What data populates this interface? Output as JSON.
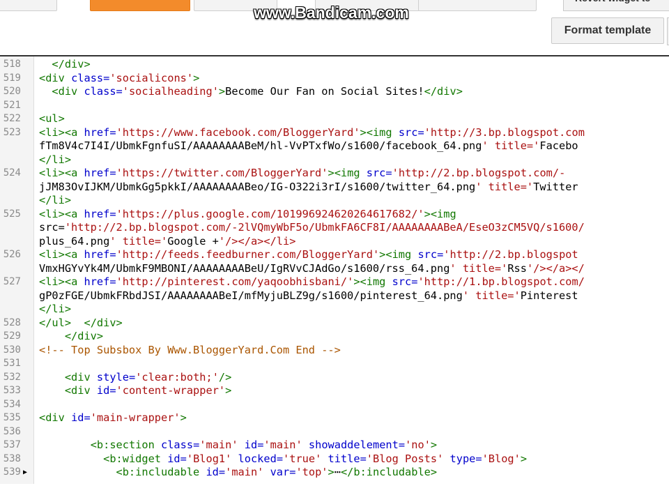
{
  "watermark": "www.Bandicam.com",
  "toolbar": {
    "format_template": "Format template",
    "revert_widget": "Revert widget te"
  },
  "editor": {
    "lines": [
      {
        "n": "518",
        "code": "  </div>"
      },
      {
        "n": "519",
        "code": "<div class='socialicons'>"
      },
      {
        "n": "520",
        "code": "  <div class='socialheading'>Become Our Fan on Social Sites!</div>"
      },
      {
        "n": "521",
        "code": ""
      },
      {
        "n": "522",
        "code": "<ul>"
      },
      {
        "n": "523",
        "code": "<li><a href='https://www.facebook.com/BloggerYard'><img src='http://3.bp.blogspot.com"
      },
      {
        "n": "",
        "code": "fTm8V4c7I4I/UbmkFgnfuSI/AAAAAAAABeM/hl-VvPTxfWo/s1600/facebook_64.png' title='Facebo"
      },
      {
        "n": "",
        "code": "</li>"
      },
      {
        "n": "524",
        "code": "<li><a href='https://twitter.com/BloggerYard'><img src='http://2.bp.blogspot.com/-"
      },
      {
        "n": "",
        "code": "jJM83OvIJKM/UbmkGg5pkkI/AAAAAAAABeo/IG-O322i3rI/s1600/twitter_64.png' title='Twitter"
      },
      {
        "n": "",
        "code": "</li>"
      },
      {
        "n": "525",
        "code": "<li><a href='https://plus.google.com/101996924620264617682/'><img"
      },
      {
        "n": "",
        "code": "src='http://2.bp.blogspot.com/-2lVQmyWbF5o/UbmkFA6CF8I/AAAAAAAABeA/EseO3zCM5VQ/s1600/"
      },
      {
        "n": "",
        "code": "plus_64.png' title='Google +'/></a></li>"
      },
      {
        "n": "526",
        "code": "<li><a href='http://feeds.feedburner.com/BloggerYard'><img src='http://2.bp.blogspot"
      },
      {
        "n": "",
        "code": "VmxHGYvYk4M/UbmkF9MBONI/AAAAAAAABeU/IgRVvCJAdGo/s1600/rss_64.png' title='Rss'/></a></"
      },
      {
        "n": "527",
        "code": "<li><a href='http://pinterest.com/yaqoobhisbani/'><img src='http://1.bp.blogspot.com/"
      },
      {
        "n": "",
        "code": "gP0zFGE/UbmkFRbdJSI/AAAAAAAABeI/mfMyjuBLZ9g/s1600/pinterest_64.png' title='Pinterest"
      },
      {
        "n": "",
        "code": "</li>"
      },
      {
        "n": "528",
        "code": "</ul>  </div>"
      },
      {
        "n": "529",
        "code": "    </div>"
      },
      {
        "n": "530",
        "code": "<!-- Top Subsbox By Www.BloggerYard.Com End -->"
      },
      {
        "n": "531",
        "code": ""
      },
      {
        "n": "532",
        "code": "    <div style='clear:both;'/>"
      },
      {
        "n": "533",
        "code": "    <div id='content-wrapper'>"
      },
      {
        "n": "534",
        "code": ""
      },
      {
        "n": "535",
        "code": "<div id='main-wrapper'>"
      },
      {
        "n": "536",
        "code": ""
      },
      {
        "n": "537",
        "code": "        <b:section class='main' id='main' showaddelement='no'>"
      },
      {
        "n": "538",
        "code": "          <b:widget id='Blog1' locked='true' title='Blog Posts' type='Blog'>"
      },
      {
        "n": "539",
        "code": "            <b:includable id='main' var='top'>⋯</b:includable>",
        "fold": true
      }
    ]
  }
}
